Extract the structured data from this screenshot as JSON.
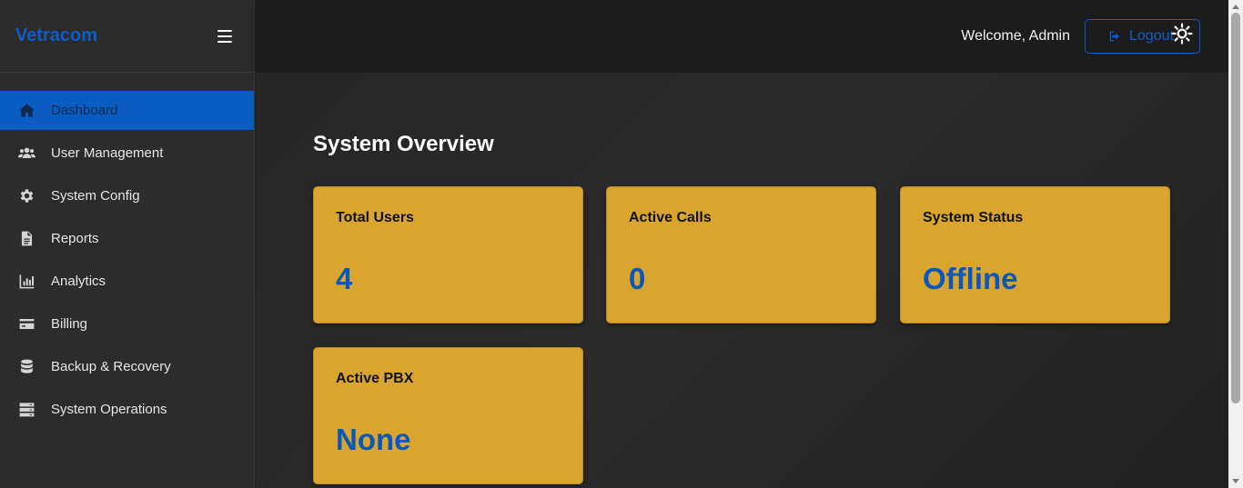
{
  "sidebar": {
    "brand": "Vetracom",
    "items": [
      {
        "label": "Dashboard",
        "icon": "home-icon",
        "active": true
      },
      {
        "label": "User Management",
        "icon": "users-icon"
      },
      {
        "label": "System Config",
        "icon": "gear-icon"
      },
      {
        "label": "Reports",
        "icon": "document-icon"
      },
      {
        "label": "Analytics",
        "icon": "bar-chart-icon"
      },
      {
        "label": "Billing",
        "icon": "credit-card-icon"
      },
      {
        "label": "Backup & Recovery",
        "icon": "database-icon"
      },
      {
        "label": "System Operations",
        "icon": "server-icon"
      }
    ]
  },
  "header": {
    "welcome": "Welcome, Admin",
    "logout_label": "Logout"
  },
  "main": {
    "title": "System Overview",
    "cards": [
      {
        "title": "Total Users",
        "value": "4"
      },
      {
        "title": "Active Calls",
        "value": "0"
      },
      {
        "title": "System Status",
        "value": "Offline"
      },
      {
        "title": "Active PBX",
        "value": "None"
      }
    ]
  },
  "colors": {
    "accent": "#0b5ec9",
    "card": "#d9a52e",
    "sidebar": "#2c2c2c",
    "topbar": "#1c1c1c"
  }
}
